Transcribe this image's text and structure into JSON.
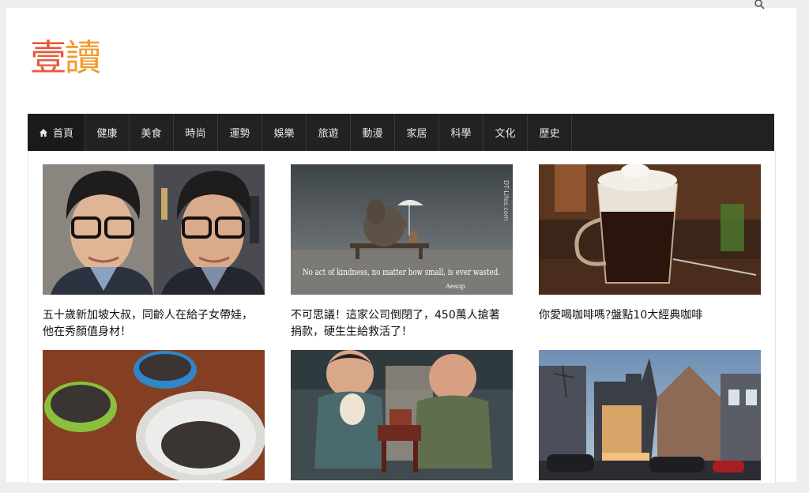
{
  "site": {
    "logo_char_1": "壹",
    "logo_char_2": "讀",
    "logo_colors": [
      "#e85a3c",
      "#f39a2a"
    ]
  },
  "nav": {
    "home_icon": "home-icon",
    "items": [
      "首頁",
      "健康",
      "美食",
      "時尚",
      "運勢",
      "娛樂",
      "旅遊",
      "動漫",
      "家居",
      "科學",
      "文化",
      "歷史"
    ]
  },
  "articles": [
    {
      "title": "五十歲新加坡大叔，同齡人在給子女帶娃，他在秀顏值身材！",
      "image": "man-with-glasses-photo"
    },
    {
      "title": "不可思議！這家公司倒閉了，450萬人搶著捐款，硬生生給救活了！",
      "image": "elephant-bench-rain-photo",
      "image_caption": "No act of kindness, no matter how small, is ever wasted.",
      "image_caption_author": "Aesop",
      "image_watermark": "DT-Lifes.com"
    },
    {
      "title": "你愛喝咖啡嗎?盤點10大經典咖啡",
      "image": "coffee-glass-photo"
    },
    {
      "title": "",
      "image": "sunflower-seeds-bowls-photo"
    },
    {
      "title": "",
      "image": "figurines-tea-photo"
    },
    {
      "title": "",
      "image": "modern-house-evening-photo"
    }
  ]
}
